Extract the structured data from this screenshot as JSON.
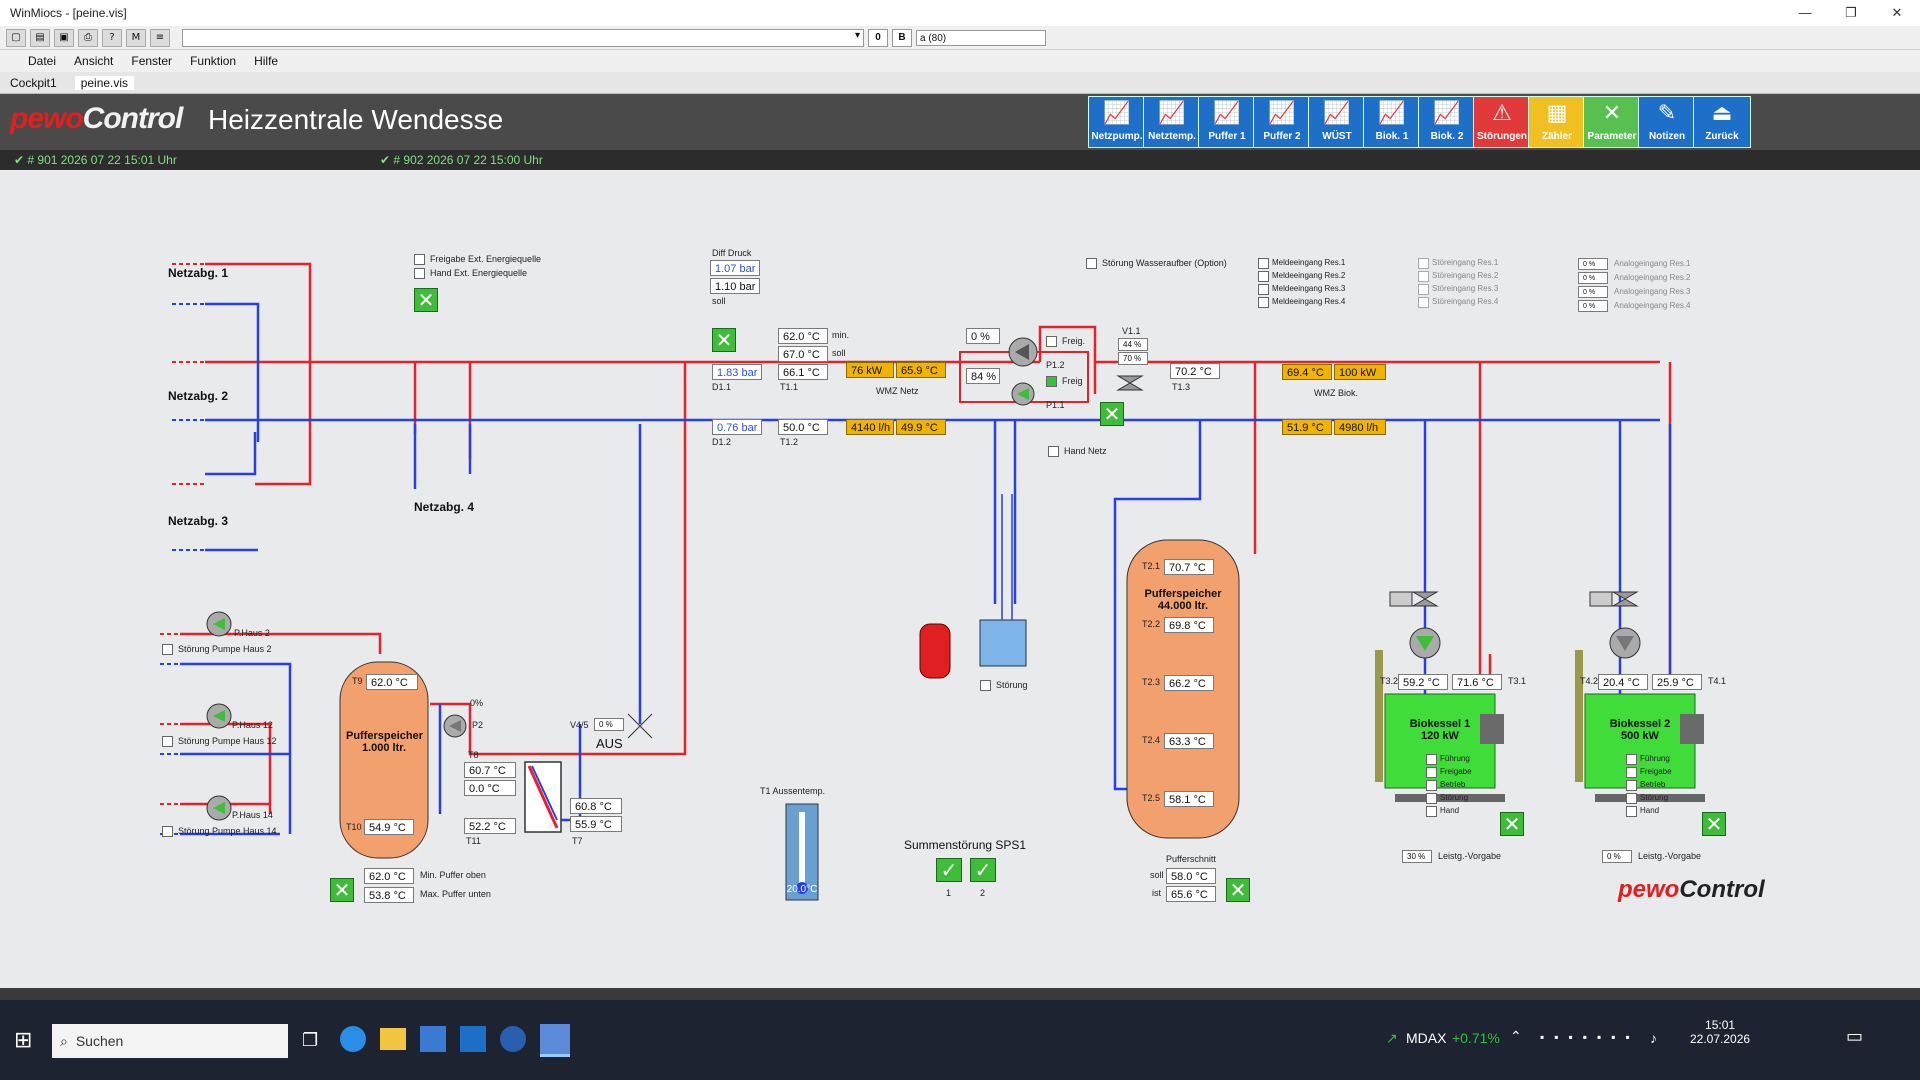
{
  "window": {
    "title": "WinMiocs - [peine.vis]"
  },
  "toolbar": {
    "obtn1": "0",
    "obtn2": "B",
    "field": "a (80)"
  },
  "menu": [
    "Datei",
    "Ansicht",
    "Fenster",
    "Funktion",
    "Hilfe"
  ],
  "tabs": [
    "Cockpit1",
    "peine.vis"
  ],
  "header": {
    "logo_a": "pewo",
    "logo_b": "Control",
    "title": "Heizzentrale Wendesse",
    "status1": "✔ # 901    2026 07 22  15:01 Uhr",
    "status2": "✔ # 902    2026 07 22  15:00 Uhr"
  },
  "nav": [
    {
      "label": "Netzpump.",
      "icon": "chart-icon"
    },
    {
      "label": "Netztemp.",
      "icon": "chart-icon"
    },
    {
      "label": "Puffer 1",
      "icon": "chart-icon"
    },
    {
      "label": "Puffer 2",
      "icon": "chart-icon"
    },
    {
      "label": "WÜST",
      "icon": "chart-icon"
    },
    {
      "label": "Biok. 1",
      "icon": "chart-icon"
    },
    {
      "label": "Biok. 2",
      "icon": "chart-icon"
    },
    {
      "label": "Störungen",
      "icon": "warning-icon"
    },
    {
      "label": "Zähler",
      "icon": "counter-icon"
    },
    {
      "label": "Parameter",
      "icon": "tools-icon"
    },
    {
      "label": "Notizen",
      "icon": "notes-icon"
    },
    {
      "label": "Zurück",
      "icon": "back-icon"
    }
  ],
  "netz": {
    "n1": "Netzabg. 1",
    "n2": "Netzabg. 2",
    "n3": "Netzabg. 3",
    "n4": "Netzabg. 4"
  },
  "ext": {
    "freigabe": "Freigabe Ext. Energiequelle",
    "hand": "Hand Ext. Energiequelle"
  },
  "diff": {
    "title": "Diff Druck",
    "v1": "1.07 bar",
    "v2": "1.10 bar",
    "soll": "soll"
  },
  "t11": {
    "min": "62.0 °C",
    "min_l": "min.",
    "soll": "67.0 °C",
    "soll_l": "soll",
    "val": "66.1 °C",
    "name": "T1.1"
  },
  "d11": {
    "val": "1.83 bar",
    "name": "D1.1"
  },
  "d12": {
    "val": "0.76 bar",
    "name": "D1.2"
  },
  "t12": {
    "val": "50.0 °C",
    "name": "T1.2"
  },
  "wmz_netz": {
    "kw": "76 kW",
    "temp1": "65.9 °C",
    "flow": "4140 l/h",
    "temp2": "49.9 °C",
    "label": "WMZ Netz"
  },
  "pumps": {
    "pct_top": "0 %",
    "pct_mid": "84 %",
    "freig1": "Freig.",
    "freig2": "Freig",
    "p12": "P1.2",
    "p11": "P1.1",
    "hand_netz": "Hand Netz"
  },
  "v11": {
    "name": "V1.1",
    "a": "44 %",
    "b": "70 %"
  },
  "t13": {
    "val": "70.2 °C",
    "name": "T1.3"
  },
  "wmz_biok": {
    "temp1": "69.4 °C",
    "kw": "100 kW",
    "temp2": "51.9 °C",
    "flow": "4980 l/h",
    "label": "WMZ Biok."
  },
  "wasser": "Störung Wasseraufber (Option)",
  "meld": [
    "Meldeeingang Res.1",
    "Meldeeingang Res.2",
    "Meldeeingang Res.3",
    "Meldeeingang Res.4"
  ],
  "stoer_res": [
    "Störeingang Res.1",
    "Störeingang Res.2",
    "Störeingang Res.3",
    "Störeingang Res.4"
  ],
  "analog": [
    {
      "v": "0 %",
      "l": "Analogeingang Res.1"
    },
    {
      "v": "0 %",
      "l": "Analogeingang Res.2"
    },
    {
      "v": "0 %",
      "l": "Analogeingang Res.3"
    },
    {
      "v": "0 %",
      "l": "Analogeingang Res.4"
    }
  ],
  "haus": {
    "p2": "P.Haus 2",
    "s2": "Störung Pumpe Haus 2",
    "p12": "P.Haus 12",
    "s12": "Störung Pumpe Haus 12",
    "p14": "P.Haus 14",
    "s14": "Störung Pumpe Haus 14"
  },
  "puffer1": {
    "title1": "Pufferspeicher",
    "title2": "1.000 ltr.",
    "t9": "T9",
    "t9v": "62.0 °C",
    "t10": "T10",
    "t10v": "54.9 °C",
    "p2": "P2",
    "p2pct": "0%",
    "t8": "T8",
    "t8v": "60.7 °C",
    "t8b": "0.0 °C",
    "t11": "T11",
    "t11v": "52.2 °C",
    "r1": "60.8 °C",
    "r2": "55.9 °C",
    "t7": "T7",
    "v45": "V4/5",
    "v45pct": "0 %",
    "aus": "AUS",
    "min": "62.0 °C",
    "min_l": "Min. Puffer oben",
    "max": "53.8 °C",
    "max_l": "Max. Puffer unten"
  },
  "aussen": {
    "label": "T1 Aussentemp.",
    "val": "20.0°C"
  },
  "sps": {
    "title": "Summenstörung SPS1",
    "n1": "1",
    "n2": "2"
  },
  "stoerung": "Störung",
  "puffer2": {
    "title1": "Pufferspeicher",
    "title2": "44.000 ltr.",
    "sensors": [
      {
        "n": "T2.1",
        "v": "70.7 °C"
      },
      {
        "n": "T2.2",
        "v": "69.8 °C"
      },
      {
        "n": "T2.3",
        "v": "66.2 °C"
      },
      {
        "n": "T2.4",
        "v": "63.3 °C"
      },
      {
        "n": "T2.5",
        "v": "58.1 °C"
      }
    ],
    "schnitt": "Pufferschnitt",
    "soll_l": "soll",
    "soll": "58.0 °C",
    "ist_l": "ist",
    "ist": "65.6 °C"
  },
  "kessel1": {
    "title1": "Biokessel 1",
    "title2": "120 kW",
    "t32": "T3.2",
    "t32v": "59.2 °C",
    "t31v": "71.6 °C",
    "t31": "T3.1",
    "st": [
      "Führung",
      "Freigabe",
      "Betrieb",
      "Störung",
      "Hand"
    ],
    "pct": "30 %",
    "vorgabe": "Leistg.-Vorgabe"
  },
  "kessel2": {
    "title1": "Biokessel 2",
    "title2": "500 kW",
    "t42": "T4.2",
    "t42v": "20.4 °C",
    "t41v": "25.9 °C",
    "t41": "T4.1",
    "st": [
      "Führung",
      "Freigabe",
      "Betrieb",
      "Störung",
      "Hand"
    ],
    "pct": "0 %",
    "vorgabe": "Leistg.-Vorgabe"
  },
  "footer_logo": {
    "a": "pewo",
    "b": "Control"
  },
  "taskbar": {
    "search": "Suchen",
    "ticker": "MDAX",
    "ticker_val": "+0.71%",
    "time": "15:01",
    "date": "22.07.2026"
  },
  "colors": {
    "supply": "#e8202a",
    "return": "#2a3ee8",
    "button": "#1e6fc8"
  }
}
